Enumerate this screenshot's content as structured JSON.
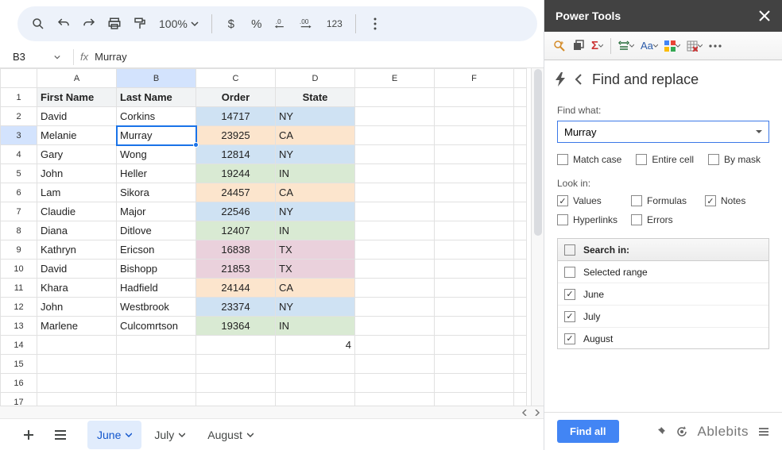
{
  "toolbar": {
    "zoom": "100%",
    "format_123": "123"
  },
  "formula_bar": {
    "cell_ref": "B3",
    "fx": "fx",
    "formula": "Murray"
  },
  "columns": [
    "A",
    "B",
    "C",
    "D",
    "E",
    "F"
  ],
  "rows": [
    "1",
    "2",
    "3",
    "4",
    "5",
    "6",
    "7",
    "8",
    "9",
    "10",
    "11",
    "12",
    "13",
    "14",
    "15",
    "16",
    "17"
  ],
  "headers": [
    "First Name",
    "Last Name",
    "Order",
    "State"
  ],
  "data": [
    {
      "first": "David",
      "last": "Corkins",
      "order": "14717",
      "state": "NY",
      "color": "c-blue"
    },
    {
      "first": "Melanie",
      "last": "Murray",
      "order": "23925",
      "state": "CA",
      "color": "c-yellow"
    },
    {
      "first": "Gary",
      "last": "Wong",
      "order": "12814",
      "state": "NY",
      "color": "c-blue"
    },
    {
      "first": "John",
      "last": "Heller",
      "order": "19244",
      "state": "IN",
      "color": "c-green"
    },
    {
      "first": "Lam",
      "last": "Sikora",
      "order": "24457",
      "state": "CA",
      "color": "c-yellow"
    },
    {
      "first": "Claudie",
      "last": "Major",
      "order": "22546",
      "state": "NY",
      "color": "c-blue"
    },
    {
      "first": "Diana",
      "last": "Ditlove",
      "order": "12407",
      "state": "IN",
      "color": "c-green"
    },
    {
      "first": "Kathryn",
      "last": "Ericson",
      "order": "16838",
      "state": "TX",
      "color": "c-pink"
    },
    {
      "first": "David",
      "last": "Bishopp",
      "order": "21853",
      "state": "TX",
      "color": "c-pink"
    },
    {
      "first": "Khara",
      "last": "Hadfield",
      "order": "24144",
      "state": "CA",
      "color": "c-yellow"
    },
    {
      "first": "John",
      "last": "Westbrook",
      "order": "23374",
      "state": "NY",
      "color": "c-blue"
    },
    {
      "first": "Marlene",
      "last": "Culcomrtson",
      "order": "19364",
      "state": "IN",
      "color": "c-green"
    }
  ],
  "row14_d": "4",
  "active_cell": {
    "row": 3,
    "col": "B"
  },
  "selected_col": "B",
  "selected_row": "3",
  "sheet_tabs": [
    "June",
    "July",
    "August"
  ],
  "active_tab": "June",
  "sidebar": {
    "header": "Power Tools",
    "title": "Find and replace",
    "find_label": "Find what:",
    "find_value": "Murray",
    "match_case": "Match case",
    "entire_cell": "Entire cell",
    "by_mask": "By mask",
    "look_in": "Look in:",
    "values": "Values",
    "formulas": "Formulas",
    "notes": "Notes",
    "hyperlinks": "Hyperlinks",
    "errors": "Errors",
    "search_in": "Search in:",
    "selected_range": "Selected range",
    "search_items": [
      "June",
      "July",
      "August"
    ],
    "find_all": "Find all",
    "brand": "Ablebits"
  }
}
